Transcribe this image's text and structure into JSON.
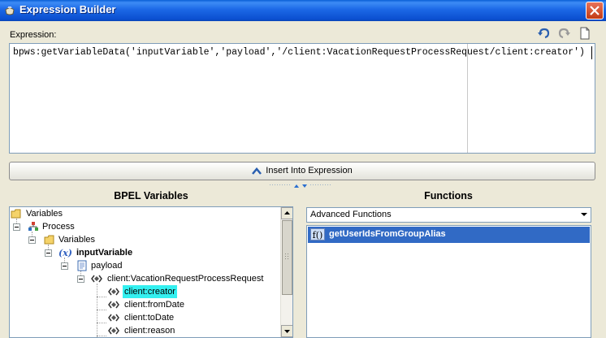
{
  "window": {
    "title": "Expression Builder"
  },
  "expression": {
    "label": "Expression:",
    "text": "bpws:getVariableData('inputVariable','payload','/client:VacationRequestProcessRequest/client:creator')"
  },
  "insert_button": {
    "label": "Insert Into Expression"
  },
  "bpel_panel": {
    "title": "BPEL Variables",
    "tree": [
      {
        "label": "Variables",
        "icon": "folder-icon"
      },
      {
        "label": "Process",
        "icon": "process-icon"
      },
      {
        "label": "Variables",
        "icon": "folder-icon"
      },
      {
        "label": "inputVariable",
        "icon": "variable-icon"
      },
      {
        "label": "payload",
        "icon": "document-icon"
      },
      {
        "label": "client:VacationRequestProcessRequest",
        "icon": "element-icon"
      },
      {
        "label": "client:creator",
        "icon": "element-icon",
        "selected": true
      },
      {
        "label": "client:fromDate",
        "icon": "element-icon"
      },
      {
        "label": "client:toDate",
        "icon": "element-icon"
      },
      {
        "label": "client:reason",
        "icon": "element-icon"
      }
    ]
  },
  "functions_panel": {
    "title": "Functions",
    "category": "Advanced Functions",
    "items": [
      {
        "label": "getUserIdsFromGroupAlias",
        "icon": "function-icon",
        "badge": "f()"
      }
    ]
  },
  "colors": {
    "titlebar": "#0b4fd0",
    "selection": "#316ac5",
    "tree_highlight": "#33f0f0"
  }
}
